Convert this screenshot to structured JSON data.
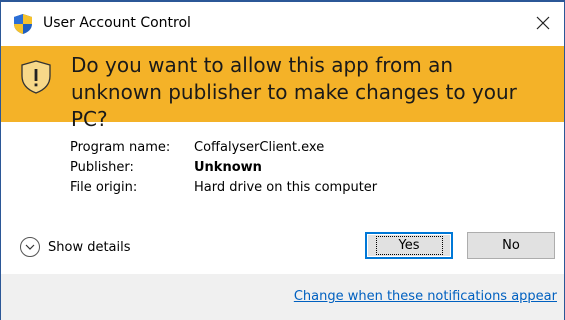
{
  "window": {
    "title": "User Account Control",
    "close_glyph": "✕"
  },
  "banner": {
    "question": "Do you want to allow this app from an unknown publisher to make changes to your PC?",
    "icon": "warning-shield-icon",
    "color": "#f4b228"
  },
  "info": {
    "rows": [
      {
        "label": "Program name:",
        "value": "CoffalyserClient.exe"
      },
      {
        "label": "Publisher:",
        "value": "Unknown"
      },
      {
        "label": "File origin:",
        "value": "Hard drive on this computer"
      }
    ]
  },
  "details": {
    "label": "Show details",
    "icon": "chevron-down-icon"
  },
  "buttons": {
    "yes": "Yes",
    "no": "No"
  },
  "footer": {
    "link": "Change when these notifications appear"
  },
  "colors": {
    "accent": "#0078d7",
    "link": "#0060c0"
  }
}
